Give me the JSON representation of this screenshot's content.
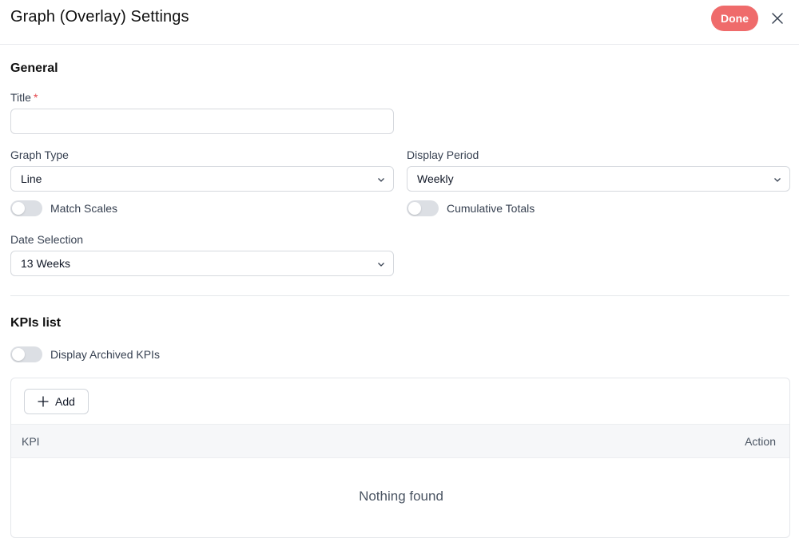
{
  "header": {
    "title": "Graph (Overlay) Settings",
    "done_label": "Done",
    "close_icon": "close-icon",
    "accent_color": "#ef6b6b"
  },
  "general": {
    "heading": "General",
    "title_field": {
      "label": "Title",
      "required_mark": "*",
      "value": ""
    },
    "graph_type": {
      "label": "Graph Type",
      "value": "Line"
    },
    "display_period": {
      "label": "Display Period",
      "value": "Weekly"
    },
    "match_scales": {
      "label": "Match Scales",
      "on": false
    },
    "cumulative_totals": {
      "label": "Cumulative Totals",
      "on": false
    },
    "date_selection": {
      "label": "Date Selection",
      "value": "13 Weeks"
    }
  },
  "kpis": {
    "heading": "KPIs list",
    "display_archived": {
      "label": "Display Archived KPIs",
      "on": false
    },
    "add_label": "Add",
    "columns": [
      "KPI",
      "Action"
    ],
    "rows": [],
    "empty_text": "Nothing found"
  }
}
